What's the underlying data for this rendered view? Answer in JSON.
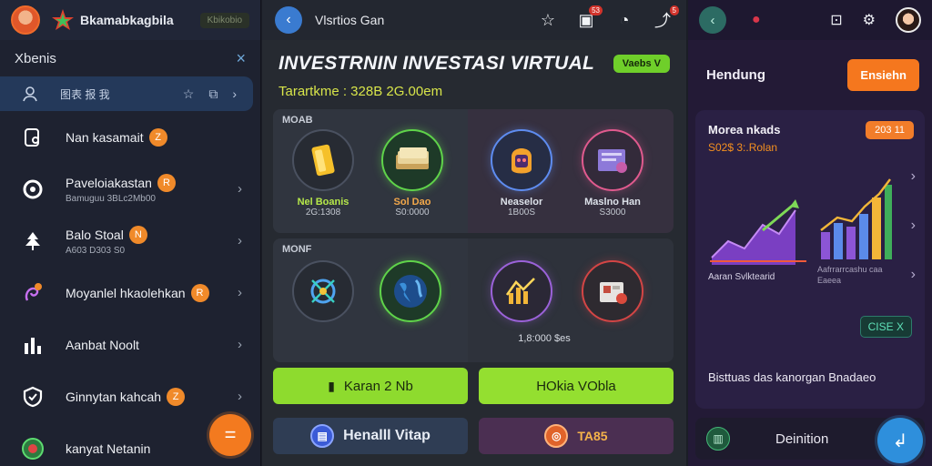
{
  "left": {
    "app_title": "Bkamabkagbila",
    "version_badge": "Kbikobio",
    "section_title": "Xbenis",
    "close_icon": "×",
    "active_text": "图表 报 我",
    "items": [
      {
        "label": "Nan kasamait",
        "sub": "",
        "badge": "Z",
        "chevron": false
      },
      {
        "label": "Paveloiakastan",
        "sub": "Bamuguu 3BLc2Mb00",
        "badge": "R",
        "chevron": true
      },
      {
        "label": "Balo Stoal",
        "sub": "A603 D303 S0",
        "badge": "N",
        "chevron": true
      },
      {
        "label": "Moyanlel hkaolehkan",
        "sub": "",
        "badge": "R",
        "chevron": true
      },
      {
        "label": "Aanbat Noolt",
        "sub": "",
        "badge": "",
        "chevron": true
      },
      {
        "label": "Ginnytan kahcah",
        "sub": "",
        "badge": "Z",
        "chevron": true
      },
      {
        "label": "kanyat Netanin",
        "sub": "",
        "badge": "",
        "chevron": false
      }
    ],
    "fab_icon": "="
  },
  "center": {
    "window_title": "Vlsrtios Gan",
    "notif_dot_1": "53",
    "notif_dot_2": "5",
    "big_title": "INVESTRNIN INVESTASI VIRTUAL",
    "subtitle": "Tarartkme : 328B 2G.00em",
    "green_pill": "Vaebs V",
    "grid1_label": "MOAB",
    "grid2_label": "MONF",
    "tiles1": [
      {
        "name": "Nel Boanis",
        "value": "2G:1308"
      },
      {
        "name": "Sol Dao",
        "value": "S0:0000"
      },
      {
        "name": "Neaselor",
        "value": "1B00S"
      },
      {
        "name": "Maslno Han",
        "value": "S3000"
      }
    ],
    "tiles2_value": "1,8:000 $es",
    "btn_lime_1": "Karan 2 Nb",
    "btn_lime_2": "HOkia VObla",
    "btn_slate": "Henalll Vitap",
    "btn_plum": "TA85"
  },
  "right": {
    "header_label": "Hendung",
    "cta_label": "Ensiehn",
    "card_title": "Morea nkads",
    "card_subtitle": "S02$ 3:.Rolan",
    "card_badge": "203 11",
    "caption1": "Aaran Svlktearid",
    "caption2": "Aafrrarrcashu caa",
    "caption3": "Eaeea",
    "close_chip": "CISE X",
    "card_footer": "Bisttuas das kanorgan Bnadaeo",
    "bottom_label": "Deinition"
  }
}
